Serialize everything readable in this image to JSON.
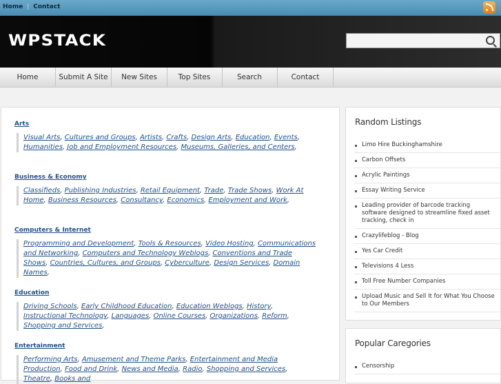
{
  "topbar": {
    "links": [
      "Home",
      "Contact"
    ],
    "rss_icon": "rss-icon"
  },
  "header": {
    "logo": "WPSTACK",
    "search": {
      "value": "",
      "placeholder": ""
    }
  },
  "nav": {
    "items": [
      "Home",
      "Submit A Site",
      "New Sites",
      "Top Sites",
      "Search",
      "Contact"
    ]
  },
  "categories": [
    {
      "title": "Arts",
      "links": [
        "Visual Arts",
        "Cultures and Groups",
        "Artists",
        "Crafts",
        "Design Arts",
        "Education",
        "Events",
        "Humanities",
        "Job and Employment Resources",
        "Museums, Galleries, and Centers"
      ]
    },
    {
      "title": "Business & Economy",
      "links": [
        "Classifieds",
        "Publishing Industries",
        "Retail Equipment",
        "Trade",
        "Trade Shows",
        "Work At Home",
        "Business Resources",
        "Consultancy",
        "Economics",
        "Employment and Work"
      ]
    },
    {
      "title": "Computers & Internet",
      "links": [
        "Programming and Development",
        "Tools & Resources",
        "Video Hosting",
        "Communications and Networking",
        "Computers and Technology Weblogs",
        "Conventions and Trade Shows",
        "Countries, Cultures, and Groups",
        "Cyberculture",
        "Design Services",
        "Domain Names"
      ]
    },
    {
      "title": "Education",
      "links": [
        "Driving Schools",
        "Early Childhood Education",
        "Education Weblogs",
        "History",
        "Instructional Technology",
        "Languages",
        "Online Courses",
        "Organizations",
        "Reform",
        "Shopping and Services"
      ]
    },
    {
      "title": "Entertainment",
      "links": [
        "Performing Arts",
        "Amusement and Theme Parks",
        "Entertainment and Media Production",
        "Food and Drink",
        "News and Media",
        "Radio",
        "Shopping and Services",
        "Theatre",
        "Books and"
      ]
    }
  ],
  "sidebar": {
    "random": {
      "title": "Random Listings",
      "items": [
        "Limo Hire Buckinghamshire",
        "Carbon Offsets",
        "Acrylic Paintings",
        "Essay Writing Service",
        "Leading provider of barcode tracking software designed to streamline fixed asset tracking, check in",
        "Crazylifeblog - Blog",
        "Yes Car Credit",
        "Televisions 4 Less",
        "Toll Free Number Companies",
        "Upload Music and Sell It for What You Choose to Our Members"
      ]
    },
    "popular": {
      "title": "Popular Caregories",
      "items": [
        "Censorship"
      ]
    }
  }
}
